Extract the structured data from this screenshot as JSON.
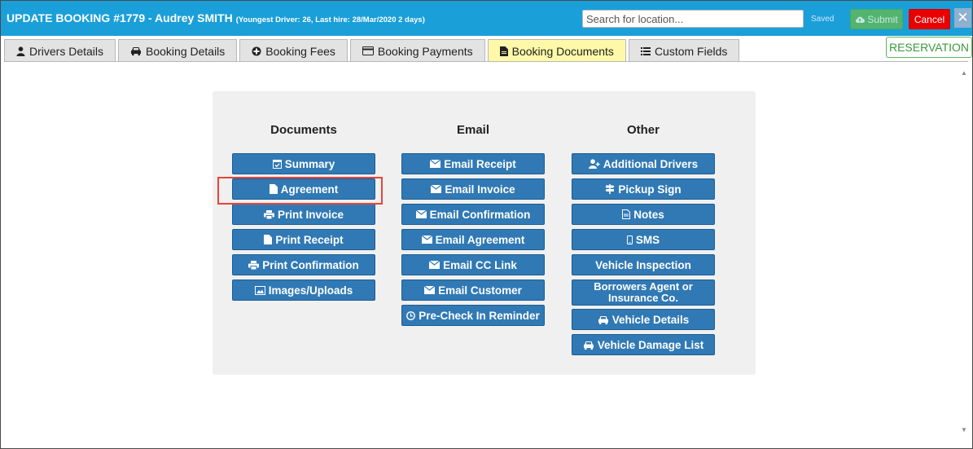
{
  "header": {
    "title": "UPDATE BOOKING #1779  - Audrey SMITH",
    "subtitle": "(Youngest Driver: 26, Last hire: 28/Mar/2020 2 days)",
    "search_placeholder": "Search for location...",
    "saved_label": "Saved",
    "submit_label": "Submit",
    "cancel_label": "Cancel",
    "close_label": "✕"
  },
  "tabs": [
    {
      "label": "Drivers Details",
      "icon": "user-icon"
    },
    {
      "label": "Booking Details",
      "icon": "car-icon"
    },
    {
      "label": "Booking Fees",
      "icon": "plus-circle-icon"
    },
    {
      "label": "Booking Payments",
      "icon": "credit-card-icon"
    },
    {
      "label": "Booking Documents",
      "icon": "document-icon",
      "active": true
    },
    {
      "label": "Custom Fields",
      "icon": "list-icon"
    }
  ],
  "reservation_label": "RESERVATION",
  "columns": {
    "documents": {
      "heading": "Documents",
      "buttons": [
        "Summary",
        "Agreement",
        "Print Invoice",
        "Print Receipt",
        "Print Confirmation",
        "Images/Uploads"
      ]
    },
    "email": {
      "heading": "Email",
      "buttons": [
        "Email Receipt",
        "Email Invoice",
        "Email Confirmation",
        "Email Agreement",
        "Email CC Link",
        "Email Customer",
        "Pre-Check In Reminder"
      ]
    },
    "other": {
      "heading": "Other",
      "buttons": [
        "Additional Drivers",
        "Pickup Sign",
        "Notes",
        "SMS",
        "Vehicle Inspection",
        "Borrowers Agent or Insurance Co.",
        "Vehicle Details",
        "Vehicle Damage List"
      ]
    }
  },
  "colors": {
    "titlebar": "#1a9fd9",
    "button": "#3079b5",
    "active_tab": "#fdf9a8",
    "highlight": "#e8443a"
  }
}
